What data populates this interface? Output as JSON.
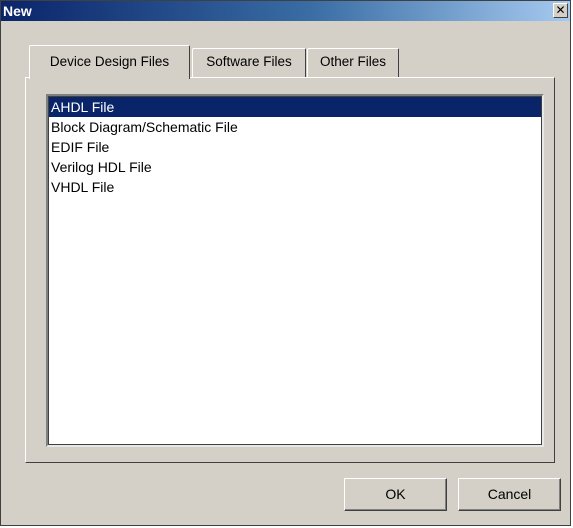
{
  "window": {
    "title": "New",
    "close_glyph": "✕",
    "close_icon": "close-icon"
  },
  "tabs": [
    {
      "label": "Device Design Files",
      "selected": true
    },
    {
      "label": "Software Files",
      "selected": false
    },
    {
      "label": "Other Files",
      "selected": false
    }
  ],
  "file_list": {
    "items": [
      {
        "label": "AHDL File",
        "selected": true
      },
      {
        "label": "Block Diagram/Schematic File",
        "selected": false
      },
      {
        "label": "EDIF File",
        "selected": false
      },
      {
        "label": "Verilog HDL File",
        "selected": false
      },
      {
        "label": "VHDL File",
        "selected": false
      }
    ]
  },
  "buttons": {
    "ok_label": "OK",
    "cancel_label": "Cancel"
  },
  "colors": {
    "selection": "#0a246a",
    "dialog_face": "#d4d0c8"
  }
}
